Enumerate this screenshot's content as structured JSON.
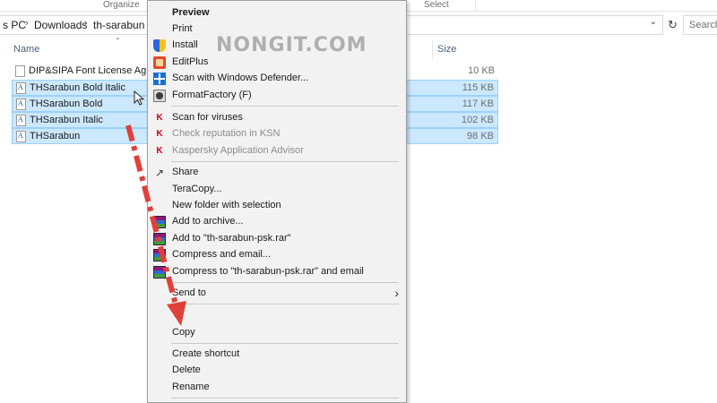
{
  "ribbon": {
    "group_organize": "Organize",
    "group_select": "Select"
  },
  "address_bar": {
    "crumbs": [
      "s PC",
      "Downloads",
      "th-sarabun"
    ],
    "separator": "›"
  },
  "search": {
    "placeholder": "Search"
  },
  "columns": {
    "name": "Name",
    "size": "Size"
  },
  "files": [
    {
      "name": "DIP&SIPA Font License Agreement",
      "size": "10 KB",
      "selected": false,
      "icon": "document-icon"
    },
    {
      "name": "THSarabun Bold Italic",
      "size": "115 KB",
      "selected": true,
      "icon": "font-file-icon"
    },
    {
      "name": "THSarabun Bold",
      "size": "117 KB",
      "selected": true,
      "icon": "font-file-icon"
    },
    {
      "name": "THSarabun Italic",
      "size": "102 KB",
      "selected": true,
      "icon": "font-file-icon"
    },
    {
      "name": "THSarabun",
      "size": "98 KB",
      "selected": true,
      "icon": "font-file-icon"
    }
  ],
  "context_menu": {
    "preview": "Preview",
    "print": "Print",
    "install": "Install",
    "editplus": "EditPlus",
    "scan_defender": "Scan with Windows Defender...",
    "formatfactory": "FormatFactory (F)",
    "scan_viruses": "Scan for viruses",
    "check_ksn": "Check reputation in KSN",
    "kaspersky_advisor": "Kaspersky Application Advisor",
    "share": "Share",
    "teracopy": "TeraCopy...",
    "new_folder_selection": "New folder with selection",
    "add_archive": "Add to archive...",
    "add_rar": "Add to \"th-sarabun-psk.rar\"",
    "compress_email": "Compress and email...",
    "compress_rar_email": "Compress to \"th-sarabun-psk.rar\" and email",
    "send_to": "Send to",
    "copy": "Copy",
    "create_shortcut": "Create shortcut",
    "delete": "Delete",
    "rename": "Rename"
  },
  "watermark": "NONGIT.COM",
  "colors": {
    "selection_fill": "#cce8ff",
    "selection_border": "#99d1ff",
    "menu_background": "#f2f2f2",
    "annotation_red": "#e0403a"
  }
}
